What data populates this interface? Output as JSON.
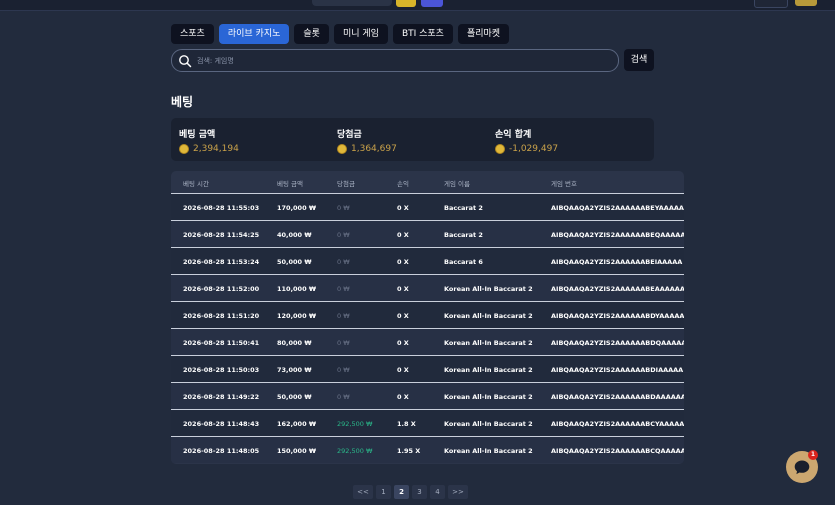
{
  "tabs": [
    {
      "label": "스포츠",
      "active": false
    },
    {
      "label": "라이브 카지노",
      "active": true
    },
    {
      "label": "슬롯",
      "active": false
    },
    {
      "label": "미니 게임",
      "active": false
    },
    {
      "label": "BTI 스포츠",
      "active": false
    },
    {
      "label": "폴리마켓",
      "active": false
    }
  ],
  "search": {
    "placeholder": "검색: 게임명",
    "button_label": "검색"
  },
  "page_title": "베팅",
  "summary": {
    "bet_label": "베팅 금액",
    "bet_value": "2,394,194",
    "win_label": "당첨금",
    "win_value": "1,364,697",
    "profit_label": "손익 합계",
    "profit_value": "-1,029,497"
  },
  "table": {
    "headers": [
      "베팅 시간",
      "베팅 금액",
      "당첨금",
      "손익",
      "게임 이름",
      "게임 번호"
    ],
    "rows": [
      {
        "time": "2026-08-28 11:55:03",
        "bet": "170,000 ₩",
        "win": "0 ₩",
        "odds": "0 X",
        "game": "Baccarat 2",
        "id": "AIBQAAQA2YZIS2AAAAAABEYAAAAA"
      },
      {
        "time": "2026-08-28 11:54:25",
        "bet": "40,000 ₩",
        "win": "0 ₩",
        "odds": "0 X",
        "game": "Baccarat 2",
        "id": "AIBQAAQA2YZIS2AAAAAABEQAAAAA"
      },
      {
        "time": "2026-08-28 11:53:24",
        "bet": "50,000 ₩",
        "win": "0 ₩",
        "odds": "0 X",
        "game": "Baccarat 6",
        "id": "AIBQAAQA2YZIS2AAAAAABEIAAAAA"
      },
      {
        "time": "2026-08-28 11:52:00",
        "bet": "110,000 ₩",
        "win": "0 ₩",
        "odds": "0 X",
        "game": "Korean All-In Baccarat 2",
        "id": "AIBQAAQA2YZIS2AAAAAABEAAAAAA"
      },
      {
        "time": "2026-08-28 11:51:20",
        "bet": "120,000 ₩",
        "win": "0 ₩",
        "odds": "0 X",
        "game": "Korean All-In Baccarat 2",
        "id": "AIBQAAQA2YZIS2AAAAAABDYAAAAA"
      },
      {
        "time": "2026-08-28 11:50:41",
        "bet": "80,000 ₩",
        "win": "0 ₩",
        "odds": "0 X",
        "game": "Korean All-In Baccarat 2",
        "id": "AIBQAAQA2YZIS2AAAAAABDQAAAAA"
      },
      {
        "time": "2026-08-28 11:50:03",
        "bet": "73,000 ₩",
        "win": "0 ₩",
        "odds": "0 X",
        "game": "Korean All-In Baccarat 2",
        "id": "AIBQAAQA2YZIS2AAAAAABDIAAAAA"
      },
      {
        "time": "2026-08-28 11:49:22",
        "bet": "50,000 ₩",
        "win": "0 ₩",
        "odds": "0 X",
        "game": "Korean All-In Baccarat 2",
        "id": "AIBQAAQA2YZIS2AAAAAABDAAAAAA"
      },
      {
        "time": "2026-08-28 11:48:43",
        "bet": "162,000 ₩",
        "win": "292,500 ₩",
        "odds": "1.8 X",
        "game": "Korean All-In Baccarat 2",
        "id": "AIBQAAQA2YZIS2AAAAAABCYAAAAA"
      },
      {
        "time": "2026-08-28 11:48:05",
        "bet": "150,000 ₩",
        "win": "292,500 ₩",
        "odds": "1.95 X",
        "game": "Korean All-In Baccarat 2",
        "id": "AIBQAAQA2YZIS2AAAAAABCQAAAAA"
      }
    ]
  },
  "pagination": {
    "prev": "<<",
    "pages": [
      "1",
      "2",
      "3",
      "4"
    ],
    "current": "2",
    "next": ">>"
  },
  "chat": {
    "badge": "1"
  },
  "colors": {
    "accent": "#2a66d6",
    "win": "#2ab98a",
    "coin": "#e0b83a",
    "badge": "#d9241e"
  },
  "icons": {
    "search": "search-icon",
    "coin": "coin-icon",
    "chat": "chat-bubble-icon"
  }
}
